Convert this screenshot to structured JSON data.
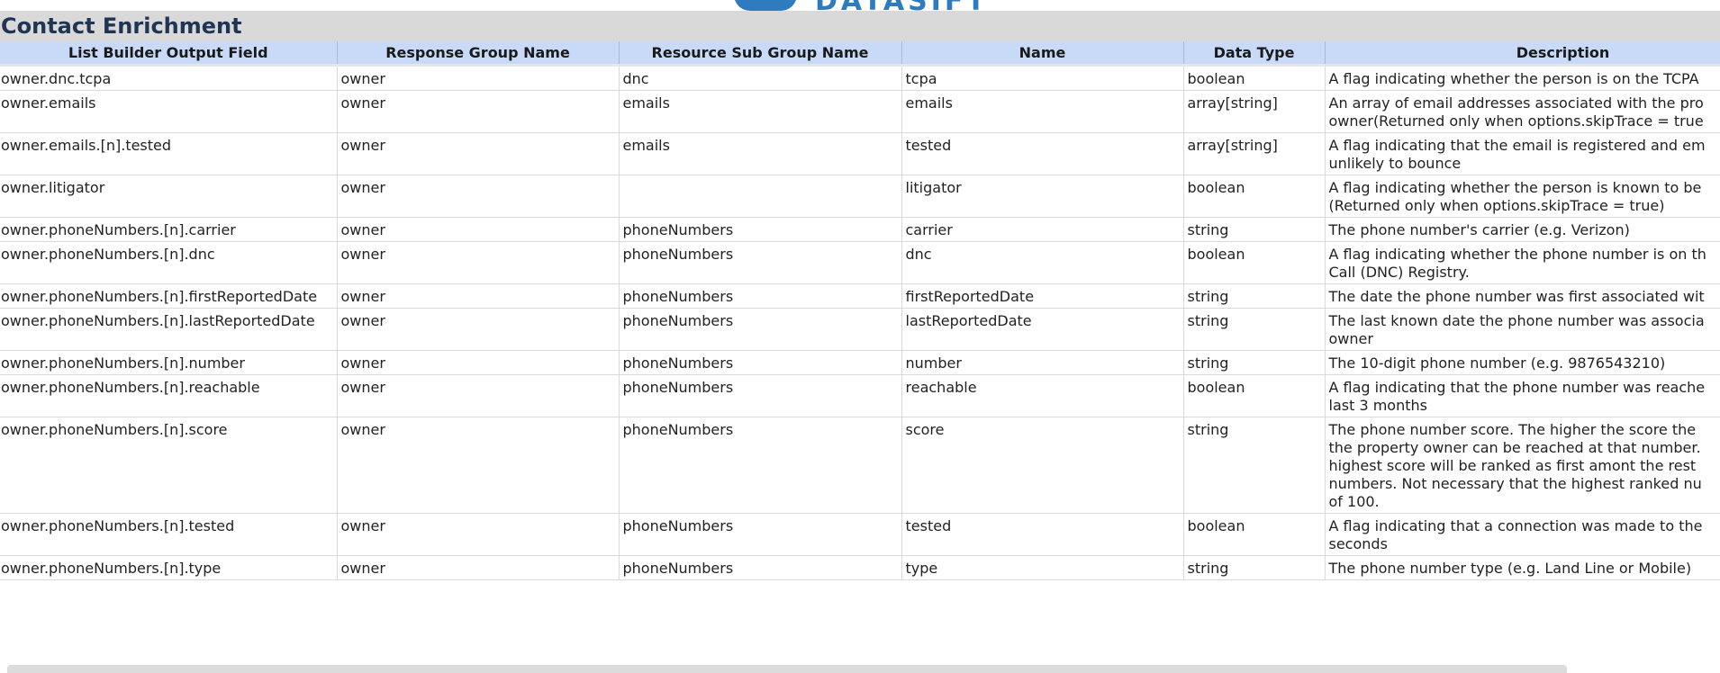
{
  "sheet": {
    "title": "Contact Enrichment",
    "logo_text": "DATASIFT"
  },
  "table": {
    "headers": [
      "List Builder Output Field",
      "Response Group Name",
      "Resource Sub Group Name",
      "Name",
      "Data Type",
      "Description"
    ],
    "rows": [
      {
        "field": "owner.dnc.tcpa",
        "group": "owner",
        "subgroup": "dnc",
        "name": "tcpa",
        "type": "boolean",
        "description": "A flag indicating whether the person is on the TCPA"
      },
      {
        "field": "owner.emails",
        "group": "owner",
        "subgroup": "emails",
        "name": "emails",
        "type": "array[string]",
        "description": "An array of email addresses associated with the pro\nowner(Returned only when options.skipTrace = true"
      },
      {
        "field": "owner.emails.[n].tested",
        "group": "owner",
        "subgroup": "emails",
        "name": "tested",
        "type": "array[string]",
        "description": "A flag indicating that the email is registered and em\nunlikely to bounce"
      },
      {
        "field": "owner.litigator",
        "group": "owner",
        "subgroup": "",
        "name": "litigator",
        "type": "boolean",
        "description": "A flag indicating whether the person is known to be\n(Returned only when options.skipTrace = true)"
      },
      {
        "field": "owner.phoneNumbers.[n].carrier",
        "group": "owner",
        "subgroup": "phoneNumbers",
        "name": "carrier",
        "type": "string",
        "description": "The phone number's carrier (e.g. Verizon)"
      },
      {
        "field": "owner.phoneNumbers.[n].dnc",
        "group": "owner",
        "subgroup": "phoneNumbers",
        "name": "dnc",
        "type": "boolean",
        "description": "A flag indicating whether the phone number is on th\nCall (DNC) Registry."
      },
      {
        "field": "owner.phoneNumbers.[n].firstReportedDate",
        "group": "owner",
        "subgroup": "phoneNumbers",
        "name": "firstReportedDate",
        "type": "string",
        "description": "The date the phone number was first associated wit"
      },
      {
        "field": "owner.phoneNumbers.[n].lastReportedDate",
        "group": "owner",
        "subgroup": "phoneNumbers",
        "name": "lastReportedDate",
        "type": "string",
        "description": "The last known date the phone number was associa\nowner"
      },
      {
        "field": "owner.phoneNumbers.[n].number",
        "group": "owner",
        "subgroup": "phoneNumbers",
        "name": "number",
        "type": "string",
        "description": "The 10-digit phone number (e.g. 9876543210)"
      },
      {
        "field": "owner.phoneNumbers.[n].reachable",
        "group": "owner",
        "subgroup": "phoneNumbers",
        "name": "reachable",
        "type": "boolean",
        "description": "A flag indicating that the phone number was reache\nlast 3 months"
      },
      {
        "field": "owner.phoneNumbers.[n].score",
        "group": "owner",
        "subgroup": "phoneNumbers",
        "name": "score",
        "type": "string",
        "description": "The phone number score. The higher the score the\nthe property owner can be reached at that number.\nhighest score will be ranked as first amont the rest\nnumbers. Not necessary that the highest ranked nu\nof 100."
      },
      {
        "field": "owner.phoneNumbers.[n].tested",
        "group": "owner",
        "subgroup": "phoneNumbers",
        "name": "tested",
        "type": "boolean",
        "description": "A flag indicating that a connection was made to the\nseconds"
      },
      {
        "field": "owner.phoneNumbers.[n].type",
        "group": "owner",
        "subgroup": "phoneNumbers",
        "name": "type",
        "type": "string",
        "description": "The phone number type (e.g. Land Line or Mobile)"
      }
    ]
  }
}
